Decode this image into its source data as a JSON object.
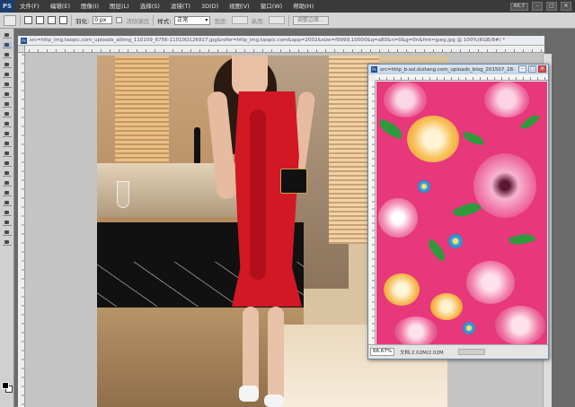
{
  "app": {
    "logo": "PS",
    "menus": [
      "文件(F)",
      "编辑(E)",
      "图像(I)",
      "图层(L)",
      "选择(S)",
      "滤镜(T)",
      "3D(D)",
      "视图(V)",
      "窗口(W)",
      "帮助(H)"
    ],
    "zoom_value": "66.7",
    "window_buttons": [
      "–",
      "□",
      "✕"
    ]
  },
  "options_bar": {
    "feather_label": "羽化:",
    "feather_value": "0 px",
    "antialias_label": "消除锯齿",
    "style_label": "样式:",
    "style_value": "正常",
    "width_label": "宽度:",
    "height_label": "高度:",
    "refine_button": "调整边缘..."
  },
  "documents": {
    "main": {
      "title": "src=http_img.taopic.com_uploads_allimg_110109_6756-11010Q126917.jpg&refer=http_img.taopic.com&app=2002&size=f9999,10000&q=a80&n=0&g=0n&fmt=jpeg.jpg @ 100%(RGB/8#) *"
    },
    "floating": {
      "title": "src=http_b-ssl.duitang.com_uploads_blog_201507_28...",
      "zoom": "66.67%",
      "doc_info": "文档:2.02M/2.02M"
    }
  },
  "colors": {
    "dress": "#d21824",
    "floral_bg": "#e6387a",
    "menubar": "#3a3a3a",
    "options_bar": "#d4d4d4"
  },
  "icons": {
    "tools": [
      "move-icon",
      "marquee-icon",
      "lasso-icon",
      "quick-select-icon",
      "crop-icon",
      "eyedropper-icon",
      "healing-icon",
      "brush-icon",
      "clone-stamp-icon",
      "history-brush-icon",
      "eraser-icon",
      "gradient-icon",
      "blur-icon",
      "dodge-icon",
      "pen-icon",
      "type-icon",
      "path-select-icon",
      "shape-icon",
      "3d-rotate-icon",
      "3d-camera-icon",
      "hand-icon",
      "zoom-icon"
    ]
  }
}
